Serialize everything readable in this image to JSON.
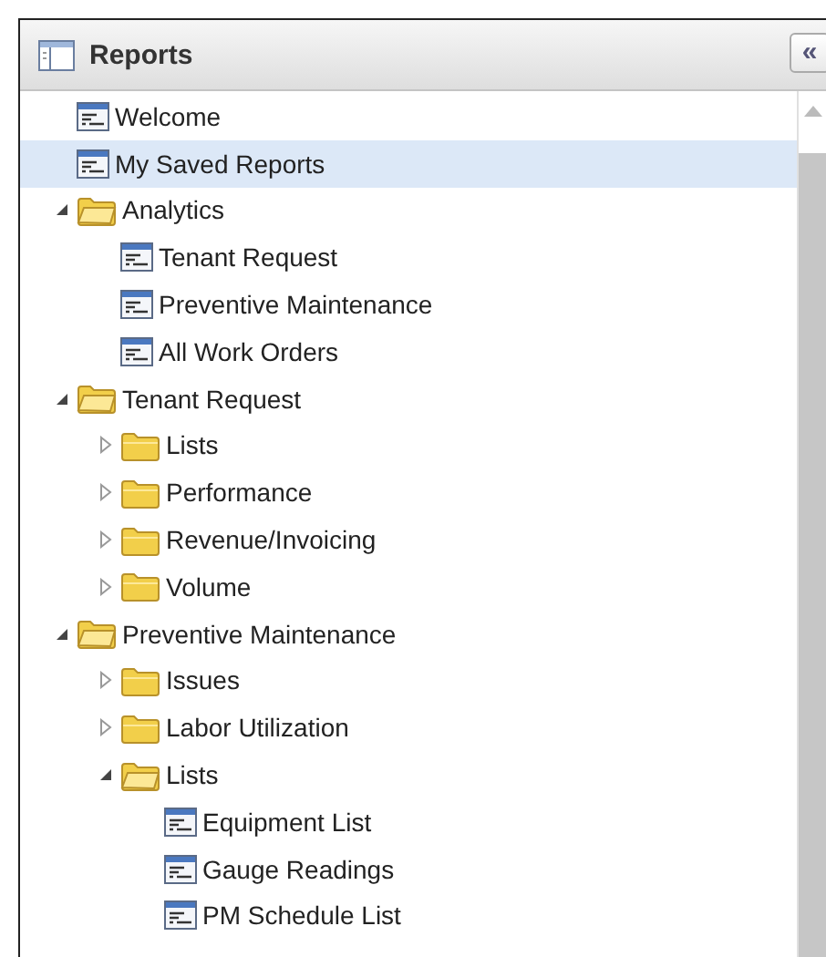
{
  "panel": {
    "title": "Reports",
    "collapse_button": "«"
  },
  "tree": [
    {
      "kind": "report",
      "label": "Welcome",
      "selected": false
    },
    {
      "kind": "report",
      "label": "My Saved Reports",
      "selected": true
    },
    {
      "kind": "folder",
      "label": "Analytics",
      "selected": false,
      "expanded": true,
      "children": [
        {
          "kind": "report",
          "label": "Tenant Request",
          "selected": false
        },
        {
          "kind": "report",
          "label": "Preventive Maintenance",
          "selected": false
        },
        {
          "kind": "report",
          "label": "All Work Orders",
          "selected": false
        }
      ]
    },
    {
      "kind": "folder",
      "label": "Tenant Request",
      "selected": false,
      "expanded": true,
      "children": [
        {
          "kind": "folder",
          "label": "Lists",
          "selected": false,
          "expanded": false
        },
        {
          "kind": "folder",
          "label": "Performance",
          "selected": false,
          "expanded": false
        },
        {
          "kind": "folder",
          "label": "Revenue/Invoicing",
          "selected": false,
          "expanded": false
        },
        {
          "kind": "folder",
          "label": "Volume",
          "selected": false,
          "expanded": false
        }
      ]
    },
    {
      "kind": "folder",
      "label": "Preventive Maintenance",
      "selected": false,
      "expanded": true,
      "children": [
        {
          "kind": "folder",
          "label": "Issues",
          "selected": false,
          "expanded": false
        },
        {
          "kind": "folder",
          "label": "Labor Utilization",
          "selected": false,
          "expanded": false
        },
        {
          "kind": "folder",
          "label": "Lists",
          "selected": false,
          "expanded": true,
          "children": [
            {
              "kind": "report",
              "label": "Equipment List",
              "selected": false
            },
            {
              "kind": "report",
              "label": "Gauge Readings",
              "selected": false
            },
            {
              "kind": "report",
              "label": "PM Schedule List",
              "selected": false
            }
          ]
        }
      ]
    }
  ]
}
